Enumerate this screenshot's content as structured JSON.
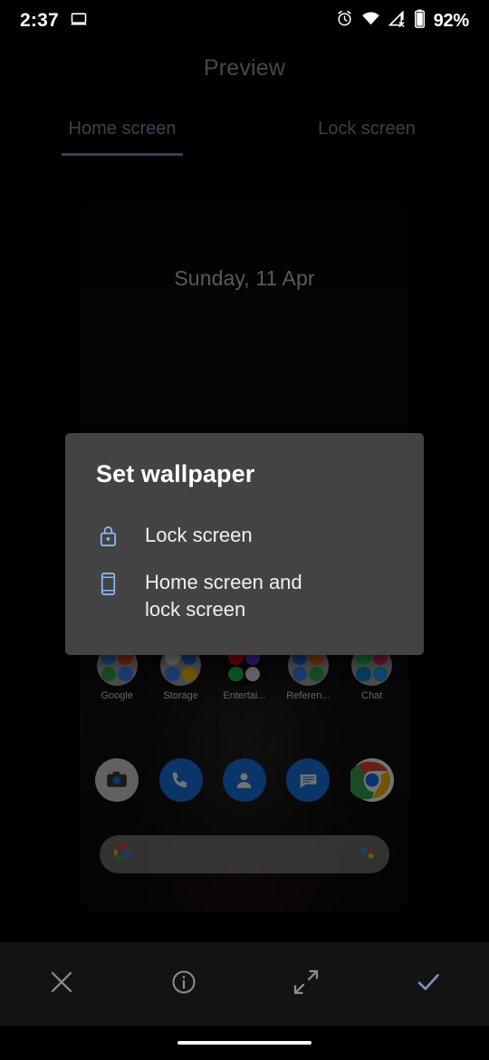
{
  "status_bar": {
    "clock": "2:37",
    "battery_label": "92%",
    "icons": [
      "screen-cast-icon",
      "alarm-icon",
      "wifi-icon",
      "signal-off-icon",
      "battery-icon"
    ]
  },
  "header": {
    "title": "Preview"
  },
  "tabs": [
    {
      "label": "Home screen",
      "active": true
    },
    {
      "label": "Lock screen",
      "active": false
    }
  ],
  "preview": {
    "date_widget": "Sunday, 11 Apr",
    "folders": [
      {
        "label": "Google",
        "dark": false,
        "colors": [
          "#4285f4",
          "#ea4335",
          "#34a853",
          "#4285f4"
        ]
      },
      {
        "label": "Storage",
        "dark": false,
        "colors": [
          "#e8eaed",
          "#1a73e8",
          "#4285f4",
          "#fbbc04"
        ]
      },
      {
        "label": "Entertai...",
        "dark": true,
        "colors": [
          "#e50914",
          "#7b2ff7",
          "#1db954",
          "#ffffff"
        ]
      },
      {
        "label": "Referen...",
        "dark": false,
        "colors": [
          "#1a73e8",
          "#e8701a",
          "#4285f4",
          "#34a853"
        ]
      },
      {
        "label": "Chat",
        "dark": false,
        "colors": [
          "#25d366",
          "#e1306c",
          "#0088cc",
          "#1da1f2"
        ]
      }
    ],
    "dock": [
      {
        "name": "camera-app-icon",
        "bg": "#d8d8d8",
        "fg": "#2b2b2b"
      },
      {
        "name": "phone-app-icon",
        "bg": "#1a73e8",
        "fg": "#ffffff"
      },
      {
        "name": "contacts-app-icon",
        "bg": "#1a73e8",
        "fg": "#ffffff"
      },
      {
        "name": "messages-app-icon",
        "bg": "#1a73e8",
        "fg": "#ffffff"
      },
      {
        "name": "chrome-app-icon",
        "bg": "#ffffff",
        "fg": "#1a73e8"
      }
    ],
    "search_bar": {
      "left_icon": "google-g-icon",
      "right_icon": "google-assistant-icon",
      "value": "",
      "placeholder": ""
    }
  },
  "dialog": {
    "title": "Set wallpaper",
    "options": [
      {
        "icon": "lock-icon",
        "label": "Lock screen"
      },
      {
        "icon": "phone-icon",
        "label": "Home screen and lock screen"
      }
    ]
  },
  "bottom_toolbar": [
    {
      "name": "close-icon",
      "label": "Close"
    },
    {
      "name": "info-icon",
      "label": "Info"
    },
    {
      "name": "expand-icon",
      "label": "Expand"
    },
    {
      "name": "confirm-check-icon",
      "label": "Apply"
    }
  ],
  "colors": {
    "accent_blue": "#8ab4f8",
    "tab_active": "#7e91b8",
    "dialog_bg": "#434343",
    "screen_bg": "#000000",
    "toolbar_bg": "#131313"
  }
}
